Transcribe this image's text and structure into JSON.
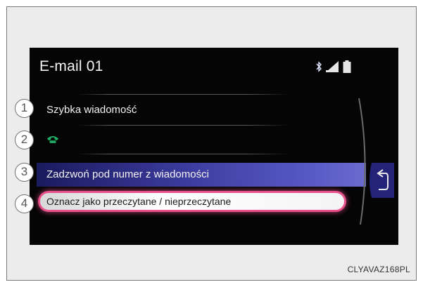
{
  "header": {
    "title": "E-mail 01",
    "status_icons": [
      "bluetooth-icon",
      "signal-icon",
      "battery-icon"
    ]
  },
  "menu": {
    "items": [
      {
        "number": "1",
        "label": "Szybka wiadomość"
      },
      {
        "number": "2",
        "label": "",
        "icon": "phone-icon"
      },
      {
        "number": "3",
        "label": "Zadzwoń pod numer z wiadomości"
      },
      {
        "number": "4",
        "label": "Oznacz jako przeczytane / nieprzeczytane"
      }
    ]
  },
  "nav": {
    "back_icon": "back-arrow-icon"
  },
  "caption": "CLYAVAZ168PL",
  "colors": {
    "screen_bg": "#050505",
    "highlight": "#4a4ab4",
    "selection_border": "#e8508a",
    "phone_icon": "#1fae63"
  }
}
